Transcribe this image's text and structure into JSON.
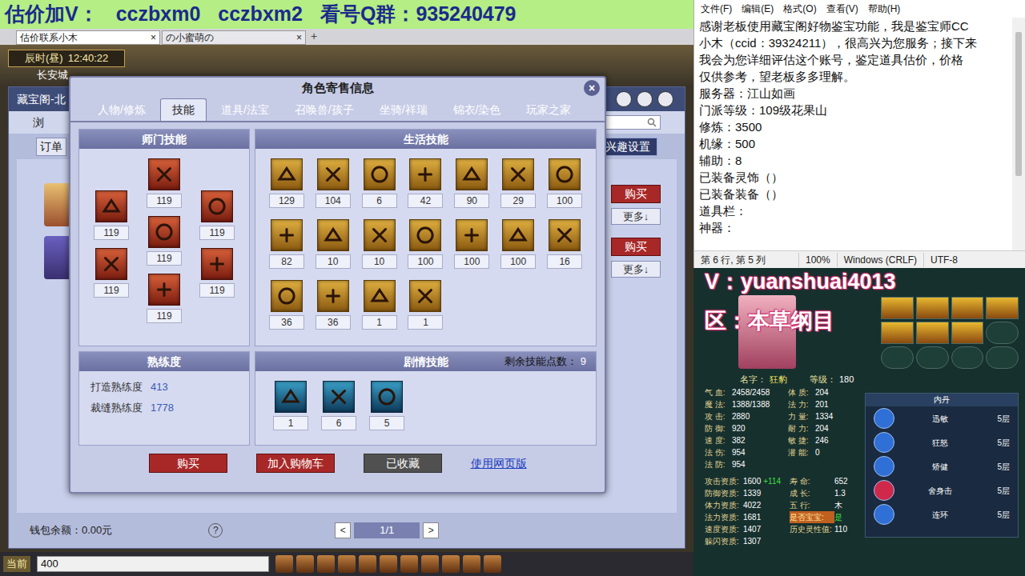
{
  "banner": {
    "segments": [
      "估价加V：",
      "cczbxm0",
      "cczbxm2",
      "看号Q群：935240479"
    ]
  },
  "browser_tabs": [
    {
      "label": "估价联系小木",
      "selected": true,
      "close": "×"
    },
    {
      "label": "の小蜜萌の",
      "selected": false,
      "close": "×"
    }
  ],
  "new_tab": "+",
  "hud": {
    "time": "辰时(昼)",
    "clock": "12:40:22",
    "location": "长安城"
  },
  "market_window": {
    "title": "藏宝阁-北",
    "search_label": "浏",
    "order_label": "订单",
    "interest_button": "兴趣设置",
    "rows": [
      {
        "buy": "购买",
        "more": "更多↓"
      },
      {
        "buy": "购买",
        "more": "更多↓"
      }
    ],
    "wallet": "钱包余额：0.00元",
    "help": "?",
    "prev": "<",
    "page": "1/1",
    "next": ">"
  },
  "dialog": {
    "title": "角色寄售信息",
    "close": "×",
    "tabs": [
      {
        "label": "人物/修炼",
        "selected": false
      },
      {
        "label": "技能",
        "selected": true
      },
      {
        "label": "道具/法宝",
        "selected": false
      },
      {
        "label": "召唤兽/孩子",
        "selected": false
      },
      {
        "label": "坐骑/祥瑞",
        "selected": false
      },
      {
        "label": "锦衣/染色",
        "selected": false
      },
      {
        "label": "玩家之家",
        "selected": false
      }
    ],
    "school": {
      "title": "师门技能",
      "columns": [
        [
          "119",
          "119"
        ],
        [
          "119",
          "119",
          "119"
        ],
        [
          "119",
          "119"
        ]
      ]
    },
    "life": {
      "title": "生活技能",
      "values": [
        "129",
        "104",
        "6",
        "42",
        "90",
        "29",
        "100",
        "82",
        "10",
        "10",
        "100",
        "100",
        "100",
        "16",
        "36",
        "36",
        "1",
        "1"
      ]
    },
    "proficiency": {
      "title": "熟练度",
      "items": [
        {
          "label": "打造熟练度",
          "value": "413"
        },
        {
          "label": "裁缝熟练度",
          "value": "1778"
        }
      ]
    },
    "story": {
      "title": "剧情技能",
      "points_label": "剩余技能点数：",
      "points": "9",
      "values": [
        "1",
        "6",
        "5"
      ]
    },
    "buttons": {
      "buy": "购买",
      "cart": "加入购物车",
      "favorited": "已收藏",
      "web": "使用网页版"
    }
  },
  "taskbar": {
    "channel": "当前",
    "input": "400"
  },
  "notepad": {
    "menu": [
      "文件(F)",
      "编辑(E)",
      "格式(O)",
      "查看(V)",
      "帮助(H)"
    ],
    "lines": [
      "感谢老板使用藏宝阁好物鉴宝功能，我是鉴宝师CC",
      "小木（ccid：39324211），很高兴为您服务；接下来",
      "我会为您详细评估这个账号，鉴定道具估价，价格",
      "仅供参考，望老板多多理解。",
      "服务器：江山如画",
      "门派等级：109级花果山",
      "修炼：3500",
      "机缘：500",
      "辅助：8",
      "已装备灵饰（）",
      "已装备装备（）",
      "道具栏：",
      "神器："
    ],
    "status": [
      "第 6 行, 第 5 列",
      "100%",
      "Windows (CRLF)",
      "UTF-8"
    ]
  },
  "character": {
    "contact": "V：yuanshuai4013",
    "region": "区：本草纲目",
    "slots": [
      {
        "filled": true
      },
      {
        "filled": true
      },
      {
        "filled": true
      },
      {
        "filled": true
      },
      {
        "filled": true
      },
      {
        "filled": true
      },
      {
        "filled": true
      },
      {
        "filled": false
      },
      {
        "filled": false
      },
      {
        "filled": false
      },
      {
        "filled": false
      },
      {
        "filled": false
      }
    ],
    "name_label": "名字：",
    "name": "狂豹",
    "level_label": "等级：",
    "level": "180",
    "stats": [
      {
        "label": "气 血:",
        "value": "2458/2458",
        "label2": "体 质:",
        "value2": "204"
      },
      {
        "label": "魔 法:",
        "value": "1388/1388",
        "label2": "法 力:",
        "value2": "201"
      },
      {
        "label": "攻 击:",
        "value": "2880",
        "label2": "力 量:",
        "value2": "1334"
      },
      {
        "label": "防 御:",
        "value": "920",
        "label2": "耐 力:",
        "value2": "204"
      },
      {
        "label": "速 度:",
        "value": "382",
        "label2": "敏 捷:",
        "value2": "246"
      },
      {
        "label": "法 伤:",
        "value": "954",
        "label2": "潜 能:",
        "value2": "0"
      },
      {
        "label": "法 防:",
        "value": "954",
        "label2": "",
        "value2": ""
      }
    ],
    "aptitudes": [
      {
        "label": "攻击资质:",
        "value": "1600",
        "bonus": "+114",
        "label2": "寿 命:",
        "value2": "652",
        "highlight": false
      },
      {
        "label": "防御资质:",
        "value": "1339",
        "bonus": "",
        "label2": "成 长:",
        "value2": "1.3",
        "highlight": false
      },
      {
        "label": "体力资质:",
        "value": "4022",
        "bonus": "",
        "label2": "五 行:",
        "value2": "木",
        "highlight": false
      },
      {
        "label": "法力资质:",
        "value": "1681",
        "bonus": "",
        "label2": "是否宝宝:",
        "value2": "是",
        "highlight": true
      },
      {
        "label": "速度资质:",
        "value": "1407",
        "bonus": "",
        "label2": "历史灵性值:",
        "value2": "110",
        "highlight": false
      },
      {
        "label": "躲闪资质:",
        "value": "1307",
        "bonus": "",
        "label2": "",
        "value2": "",
        "highlight": false
      }
    ],
    "neidan": {
      "title": "内丹",
      "items": [
        {
          "name": "迅敏",
          "layer": "5层",
          "color": "#2f6fd6"
        },
        {
          "name": "狂怒",
          "layer": "5层",
          "color": "#2f6fd6"
        },
        {
          "name": "矫健",
          "layer": "5层",
          "color": "#2f6fd6"
        },
        {
          "name": "舍身击",
          "layer": "5层",
          "color": "#d0284a"
        },
        {
          "name": "连环",
          "layer": "5层",
          "color": "#2f6fd6"
        }
      ]
    }
  }
}
